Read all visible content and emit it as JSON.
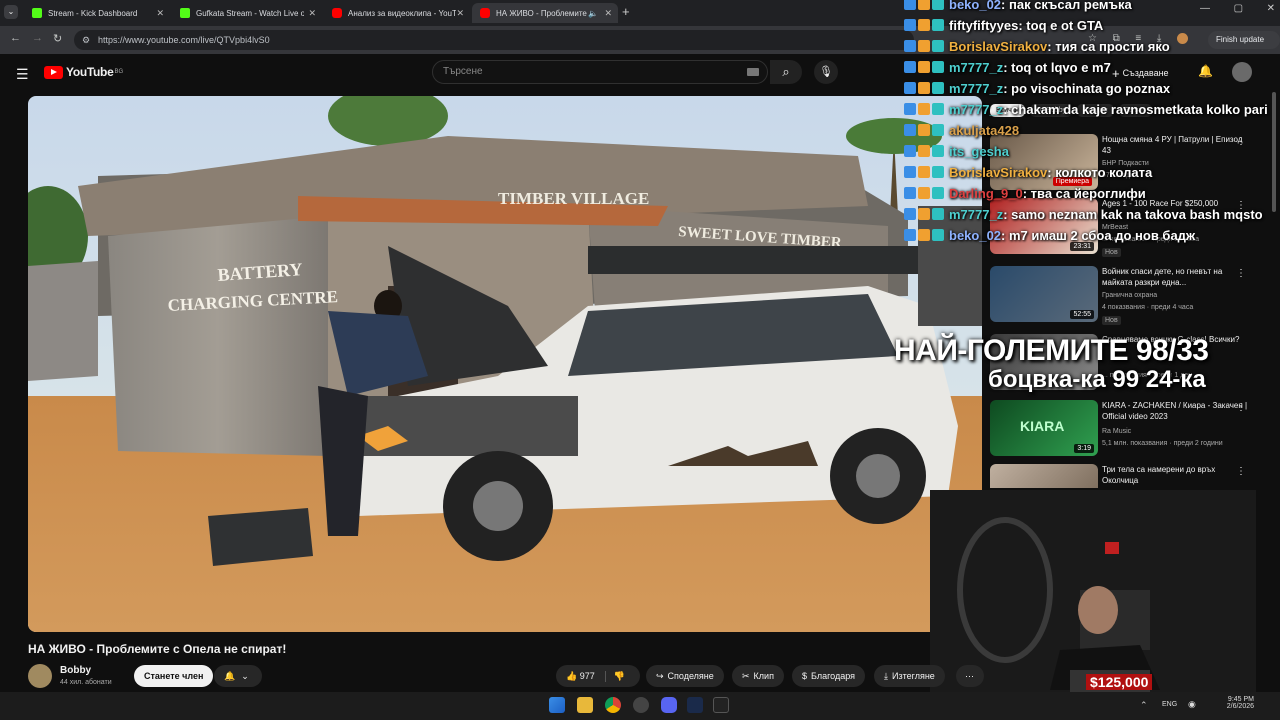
{
  "tabs": [
    {
      "label": "Stream - Kick Dashboard",
      "color": "#53fc18"
    },
    {
      "label": "Gufkata Stream - Watch Live on",
      "color": "#53fc18"
    },
    {
      "label": "Анализ за видеоклипа - YouTube",
      "color": "#ff0000"
    },
    {
      "label": "НА ЖИВО - Проблемите с...",
      "color": "#ff0000"
    }
  ],
  "url": "https://www.youtube.com/live/QTVpbi4lvS0",
  "browser": {
    "finish_update": "Finish update"
  },
  "yt": {
    "logo": "YouTube",
    "region": "BG",
    "search_placeholder": "Търсене",
    "create": "Създаване"
  },
  "chips": [
    "Всички",
    "От Bobby",
    "Сродни",
    "За вас"
  ],
  "chat": [
    {
      "user": "beko_02",
      "ucolor": "#8fb3ff",
      "msg": "пак скъсал ремъка"
    },
    {
      "user": "fiftyfiftyyes",
      "ucolor": "#ffffff",
      "msg": "toq e ot GTA"
    },
    {
      "user": "BorislavSirakov",
      "ucolor": "#f0b040",
      "msg": "тия са прости яко"
    },
    {
      "user": "m7777_z",
      "ucolor": "#4ecfcf",
      "msg": "toq ot lqvo e m7"
    },
    {
      "user": "m7777_z",
      "ucolor": "#4ecfcf",
      "msg": "po visochinata go poznax"
    },
    {
      "user": "m7777_z",
      "ucolor": "#4ecfcf",
      "msg": "chakam da kaje ravnosmetkata kolko pari"
    },
    {
      "user": "akuljata428",
      "ucolor": "#d9a04a",
      "msg": ""
    },
    {
      "user": "its_gesha",
      "ucolor": "#4ecfcf",
      "msg": ""
    },
    {
      "user": "BorislavSirakov",
      "ucolor": "#f0b040",
      "msg": "колкото колата"
    },
    {
      "user": "Darling_9_0",
      "ucolor": "#e04040",
      "msg": "тва са йероглифи"
    },
    {
      "user": "m7777_z",
      "ucolor": "#4ecfcf",
      "msg": "samo neznam kak na takova bash mqsto"
    },
    {
      "user": "beko_02",
      "ucolor": "#8fb3ff",
      "msg": "m7 имаш 2 сбоа до нов бадж"
    }
  ],
  "overlay": {
    "line1": "НАЙ-ГОЛЕМИТЕ 98/33",
    "line2": "боцвка-ка 99 24-ка"
  },
  "sidebar": [
    {
      "title": "Нощна смяна 4 РУ | Патрули | Епизод 43",
      "channel": "БНР Подкасти",
      "meta": "670 гледат",
      "badge": "Премиера",
      "duration": ""
    },
    {
      "title": "Ages 1 - 100 Race For $250,000",
      "channel": "MrBeast",
      "meta": "... показвания · преди 23 часа",
      "badge": "Нов",
      "duration": "23:31"
    },
    {
      "title": "Войник спаси дете, но гневът на майката разкри една...",
      "channel": "Гранична охрана",
      "meta": "4 показвания · преди 4 часа",
      "badge": "Нов",
      "duration": "52:55"
    },
    {
      "title": "Сравняваме всички G-class! Всички?",
      "channel": "",
      "meta": "... показвания · преди 1 ден",
      "badge": "",
      "duration": ""
    },
    {
      "title": "KIARA - ZACHAKEN / Киара - Закачен | Official video 2023",
      "channel": "Ra Music",
      "meta": "5,1 млн. показвания · преди 2 години",
      "badge": "",
      "duration": "3:19"
    },
    {
      "title": "Три тела са намерени до връх Околчица",
      "channel": "",
      "meta": "",
      "badge": "",
      "duration": ""
    }
  ],
  "video": {
    "title": "НА ЖИВО - Проблемите с Опела не спират!",
    "sign1": "BATTERY CHARGING CENTRE",
    "sign2": "TIMBER VILLAGE",
    "sign3": "SWEET LOVE TIMBER"
  },
  "channel": {
    "name": "Bobby",
    "subs": "44 хил. абонати",
    "join": "Станете член"
  },
  "actions": {
    "likes": "977",
    "share": "Споделяне",
    "clip": "Клип",
    "thanks": "Благодаря",
    "download": "Изтегляне"
  },
  "cam": {
    "donation": "$125,000"
  },
  "taskbar": {
    "lang": "ENG",
    "time": "9:45 PM",
    "date": "2/6/2026"
  }
}
